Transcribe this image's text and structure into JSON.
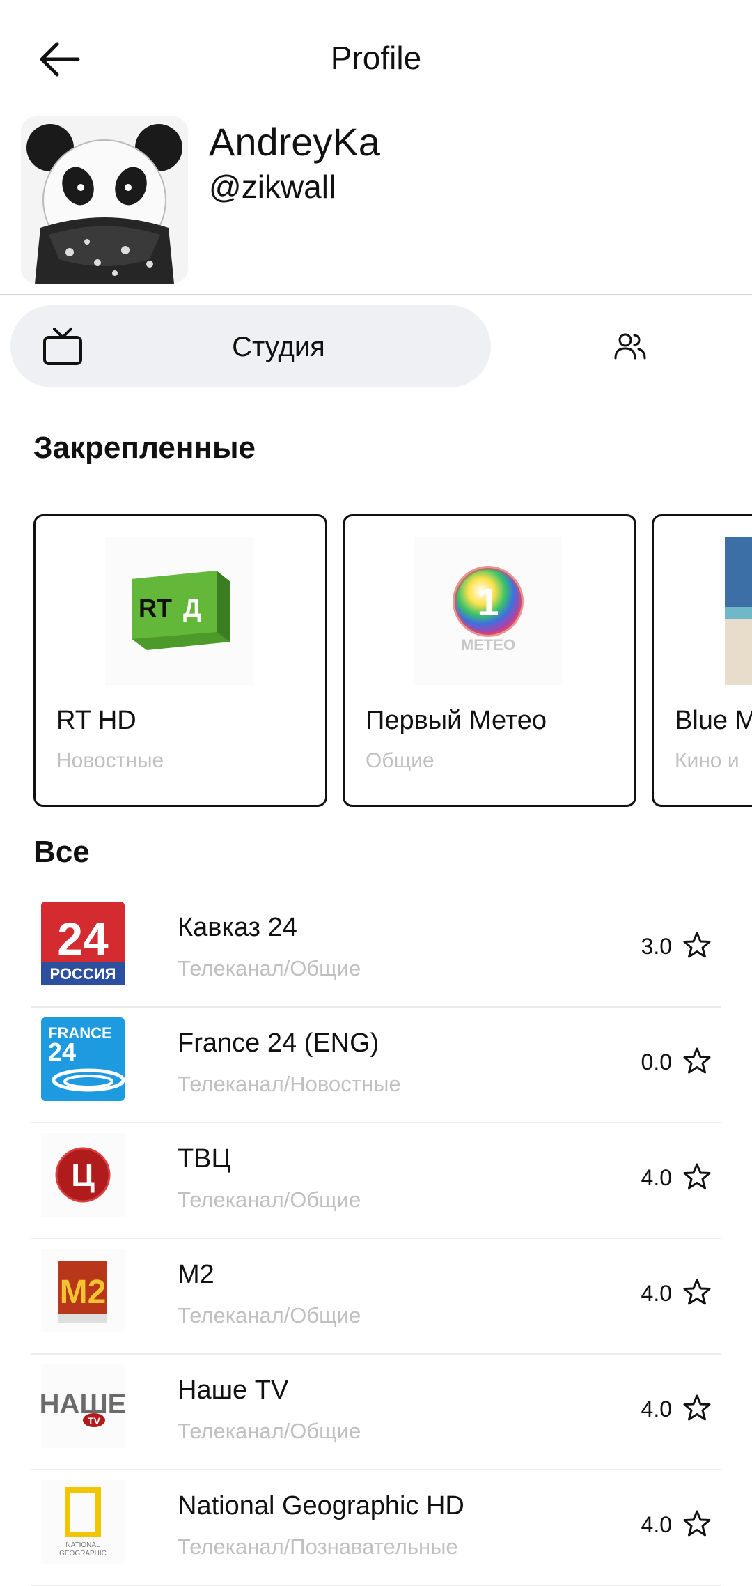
{
  "header": {
    "title": "Profile"
  },
  "profile": {
    "username": "AndreyKa",
    "handle": "@zikwall"
  },
  "tabs": {
    "studio_label": "Студия"
  },
  "pinned": {
    "title": "Закрепленные",
    "cards": [
      {
        "name": "RT HD",
        "category": "Новостные",
        "logo": "rt-d-logo"
      },
      {
        "name": "Первый Метео",
        "category": "Общие",
        "logo": "meteo-logo"
      },
      {
        "name": "Blue M",
        "category": "Кино и",
        "logo": "blue-sea-thumbnail"
      }
    ]
  },
  "all": {
    "title": "Все",
    "channels": [
      {
        "name": "Кавказ 24",
        "category": "Телеканал/Общие",
        "rating": "3.0",
        "logo": "24-russia-logo"
      },
      {
        "name": "France 24 (ENG)",
        "category": "Телеканал/Новостные",
        "rating": "0.0",
        "logo": "france-24-logo"
      },
      {
        "name": "ТВЦ",
        "category": "Телеканал/Общие",
        "rating": "4.0",
        "logo": "tvc-logo"
      },
      {
        "name": "M2",
        "category": "Телеканал/Общие",
        "rating": "4.0",
        "logo": "m2-logo"
      },
      {
        "name": "Наше TV",
        "category": "Телеканал/Общие",
        "rating": "4.0",
        "logo": "nashe-tv-logo"
      },
      {
        "name": "National Geographic HD",
        "category": "Телеканал/Познавательные",
        "rating": "4.0",
        "logo": "national-geographic-logo"
      }
    ]
  },
  "colors": {
    "tab_active_bg": "#eff0f3",
    "subtitle_gray": "#c0c0c0",
    "card_border": "#111111"
  }
}
